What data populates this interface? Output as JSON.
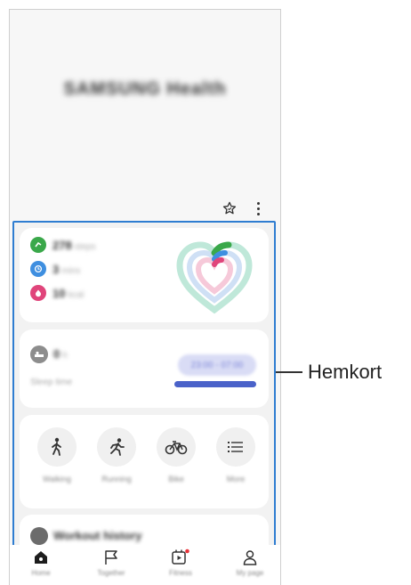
{
  "header": {
    "app_title": "SAMSUNG Health",
    "icons": [
      "star-outline-icon",
      "more-vertical-icon"
    ]
  },
  "summary_card": {
    "metrics": [
      {
        "value": "278",
        "unit": "steps",
        "color": "#3aa84a",
        "icon": "steps-icon"
      },
      {
        "value": "3",
        "unit": "mins",
        "color": "#3f8fe0",
        "icon": "active-time-icon"
      },
      {
        "value": "10",
        "unit": "kcal",
        "color": "#e0457b",
        "icon": "calories-icon"
      }
    ]
  },
  "sleep_card": {
    "value": "0",
    "unit": "h",
    "subtitle": "Sleep time",
    "time_range": "23:00 - 07:00"
  },
  "activities": [
    {
      "label": "Walking",
      "icon": "walking-icon"
    },
    {
      "label": "Running",
      "icon": "running-icon"
    },
    {
      "label": "Bike",
      "icon": "bike-icon"
    },
    {
      "label": "More",
      "icon": "list-icon"
    }
  ],
  "workout_card": {
    "title": "Workout history"
  },
  "bottom_nav": [
    {
      "label": "Home",
      "icon": "home-icon"
    },
    {
      "label": "Together",
      "icon": "flag-icon"
    },
    {
      "label": "Fitness",
      "icon": "fitness-play-icon"
    },
    {
      "label": "My page",
      "icon": "person-icon"
    }
  ],
  "callout": {
    "label": "Hemkort"
  },
  "colors": {
    "highlight_border": "#2f7dd1",
    "sleep_bar": "#4a62c9",
    "notification_dot": "#e8333a"
  }
}
